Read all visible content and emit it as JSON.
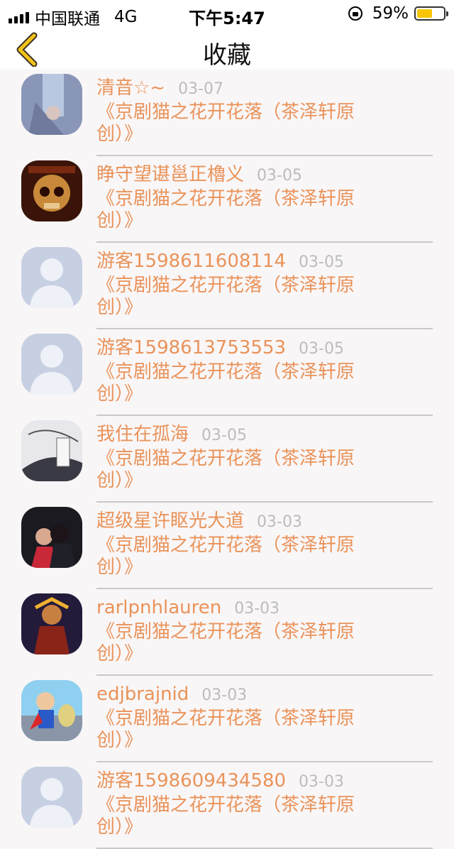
{
  "status_bar": {
    "carrier": "中国联通",
    "network": "4G",
    "time": "下午5:47",
    "battery_percent": "59%",
    "battery_level": 0.59,
    "battery_color": "#f7c600"
  },
  "nav": {
    "title": "收藏",
    "back_icon": "chevron-left-icon",
    "back_color": "#f2c21b"
  },
  "accent_color": "#e9935a",
  "items": [
    {
      "name": "清音☆~",
      "date": "03-07",
      "title": "《京剧猫之花开花落（茶泽轩原创）》",
      "avatar": "photo-blurred"
    },
    {
      "name": "睁守望谌邕正櫓义",
      "date": "03-05",
      "title": "《京剧猫之花开花落（茶泽轩原创）》",
      "avatar": "skull-album-art"
    },
    {
      "name": "游客1598611608114",
      "date": "03-05",
      "title": "《京剧猫之花开花落（茶泽轩原创）》",
      "avatar": "default-user"
    },
    {
      "name": "游客1598613753553",
      "date": "03-05",
      "title": "《京剧猫之花开花落（茶泽轩原创）》",
      "avatar": "default-user"
    },
    {
      "name": "我住在孤海",
      "date": "03-05",
      "title": "《京剧猫之花开花落（茶泽轩原创）》",
      "avatar": "ink-painting"
    },
    {
      "name": "超级星许眍光大道",
      "date": "03-03",
      "title": "《京剧猫之花开花落（茶泽轩原创）》",
      "avatar": "couple-photo"
    },
    {
      "name": "rarlpnhlauren",
      "date": "03-03",
      "title": "《京剧猫之花开花落（茶泽轩原创）》",
      "avatar": "warrior-art"
    },
    {
      "name": "edjbrajnid",
      "date": "03-03",
      "title": "《京剧猫之花开花落（茶泽轩原创）》",
      "avatar": "cartoon-hero"
    },
    {
      "name": "游客1598609434580",
      "date": "03-03",
      "title": "《京剧猫之花开花落（茶泽轩原创）》",
      "avatar": "default-user"
    }
  ]
}
